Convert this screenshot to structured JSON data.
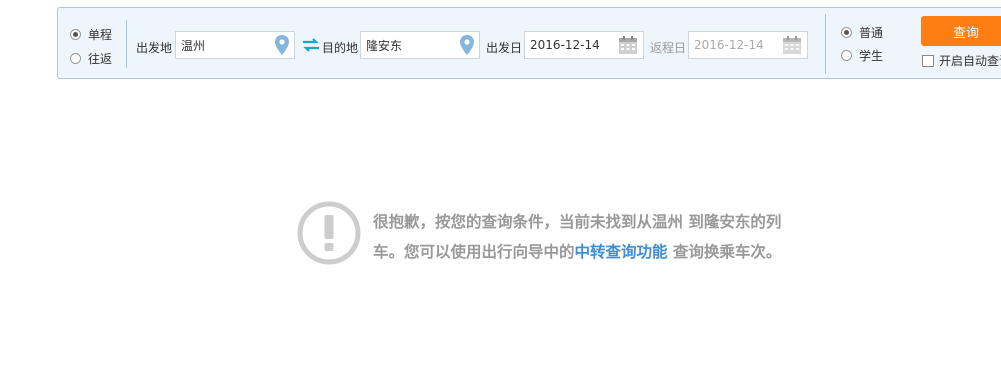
{
  "trip_type": {
    "one_way": "单程",
    "round_trip": "往返",
    "selected": "one_way"
  },
  "from": {
    "label": "出发地",
    "value": "温州"
  },
  "to": {
    "label": "目的地",
    "value": "隆安东"
  },
  "depart": {
    "label": "出发日",
    "value": "2016-12-14"
  },
  "return": {
    "label": "返程日",
    "value": "2016-12-14"
  },
  "passenger": {
    "normal": "普通",
    "student": "学生",
    "selected": "normal"
  },
  "query_button": "查询",
  "auto_query_label": "开启自动查询",
  "notice": {
    "text_before": "很抱歉，按您的查询条件，当前未找到从温州 到隆安东的列车。您可以使用出行向导中的",
    "link": "中转查询功能",
    "text_after": " 查询换乘车次。"
  },
  "colors": {
    "accent": "#ff7e13",
    "link": "#3b8fd8",
    "border": "#a7c7e3"
  }
}
